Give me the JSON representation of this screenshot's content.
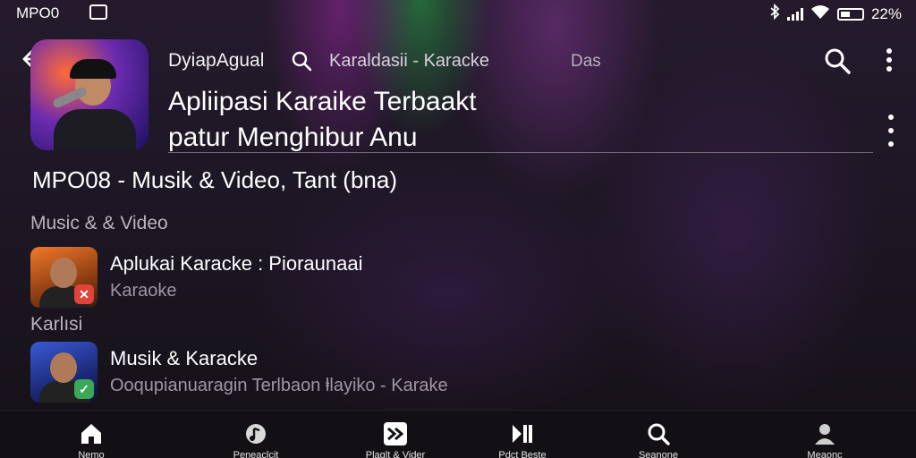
{
  "status": {
    "time": "MPO0",
    "battery": "22%"
  },
  "header": {
    "brand": "DyiapAgual",
    "breadcrumb": "Karaldasii - Karacke",
    "extra": "Das",
    "title_line1": "Apliipasi Karaike Terbaakt",
    "title_line2": "patur Menghibur Anu"
  },
  "subtitle": "MPO08 - Musik & Video, Tant (bna)",
  "sections": [
    {
      "title": "Music & & Video",
      "items": [
        {
          "title": "Aplukai Karacke : Pioraunaai",
          "subtitle": "Karaoke",
          "badge_icon": "x-icon",
          "badge_color": "#e0433a"
        }
      ]
    },
    {
      "title": "Karlısi",
      "items": [
        {
          "title": "Musik & Karacke",
          "subtitle": "Ooqupianuaragin Terlbaon ⱡlayiko - Karake",
          "badge_icon": "check-icon",
          "badge_color": "#3aa856"
        }
      ]
    }
  ],
  "nav": [
    {
      "label": "Nemo",
      "icon": "home-icon"
    },
    {
      "label": "Peneaclcit",
      "icon": "music-icon"
    },
    {
      "label": "Plaglt & Vider",
      "icon": "forward-icon"
    },
    {
      "label": "Pdct Beste",
      "icon": "play-pause-icon"
    },
    {
      "label": "Seanone",
      "icon": "search-icon"
    },
    {
      "label": "Meaonc",
      "icon": "profile-icon"
    }
  ]
}
